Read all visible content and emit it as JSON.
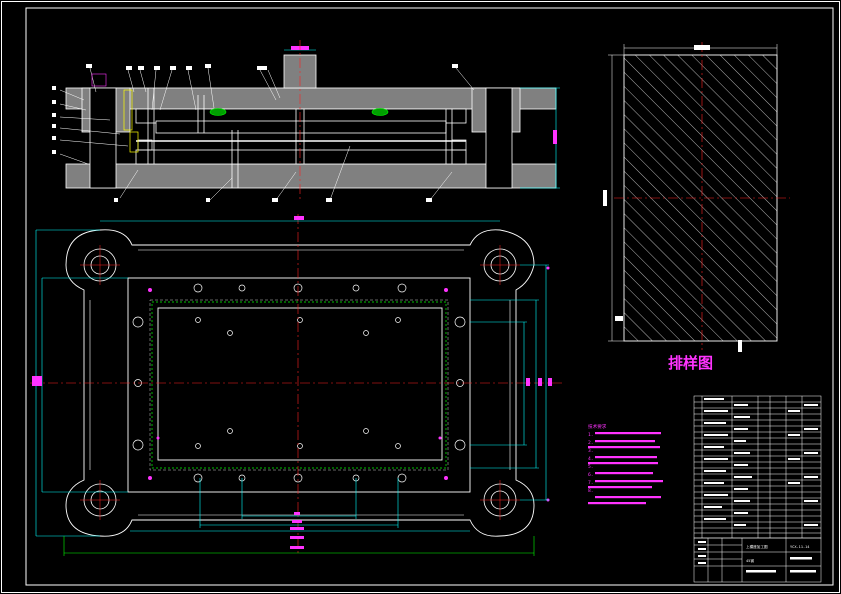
{
  "sheet": {
    "layout_title": "排样图",
    "notes": [
      "技术要求",
      "1.",
      "2.",
      "3.",
      "4.",
      "5.",
      "6.",
      "7.",
      "8."
    ],
    "title_block": {
      "drawing_name": "上模座加工图",
      "drawing_no": "YCX-11-14",
      "material": "45钢"
    }
  },
  "colors": {
    "background": "#000000",
    "line": "#ffffff",
    "dimension": "#00ffff",
    "text": "#ff33ff",
    "center": "#ff2020",
    "hidden": "#00ff00",
    "hatch": "#ffffff",
    "accent_yellow": "#ffff00",
    "gray_part": "#808080"
  }
}
